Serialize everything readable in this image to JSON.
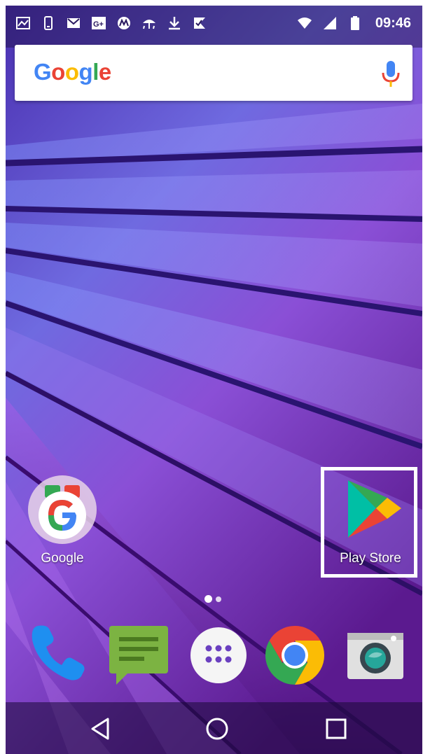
{
  "status_bar": {
    "time": "09:46",
    "left_icons": [
      "gallery-icon",
      "phone-update-icon",
      "gmail-icon",
      "google-plus-icon",
      "motorola-icon",
      "weather-icon",
      "download-icon",
      "checklist-icon"
    ],
    "right_icons": [
      "wifi-icon",
      "signal-icon",
      "battery-icon"
    ]
  },
  "search_bar": {
    "logo_letters": [
      "G",
      "o",
      "o",
      "g",
      "l",
      "e"
    ],
    "logo_colors": [
      "#4285F4",
      "#EA4335",
      "#FBBC05",
      "#4285F4",
      "#34A853",
      "#EA4335"
    ]
  },
  "home_apps": [
    {
      "label": "Google",
      "icon": "google-folder-icon"
    },
    {
      "label": "Play Store",
      "icon": "play-store-icon"
    }
  ],
  "page_indicator": {
    "pages": 2,
    "current": 1
  },
  "dock": [
    {
      "icon": "phone-icon"
    },
    {
      "icon": "messages-icon"
    },
    {
      "icon": "app-drawer-icon"
    },
    {
      "icon": "chrome-icon"
    },
    {
      "icon": "camera-icon"
    }
  ],
  "nav_bar": {
    "buttons": [
      "back-icon",
      "home-icon",
      "recents-icon"
    ]
  }
}
